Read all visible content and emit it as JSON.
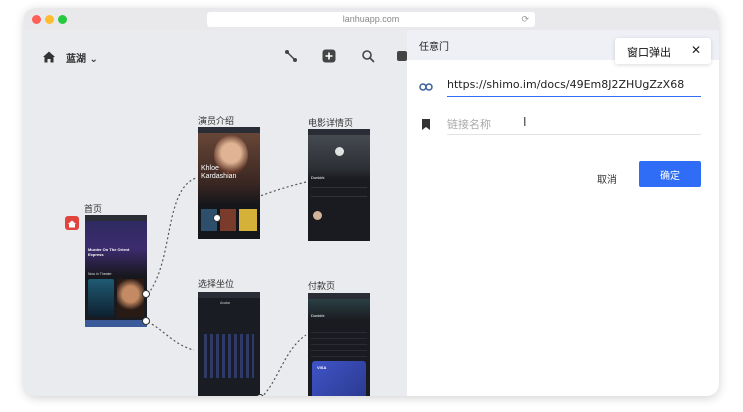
{
  "browser": {
    "url": "lanhuapp.com"
  },
  "toolbar": {
    "project_name": "蓝湖"
  },
  "artboards": {
    "home": {
      "label": "首页",
      "movie_title": "Murder On The Orient Express",
      "section": "Now in Theater"
    },
    "cast": {
      "label": "演员介绍",
      "actor_name": "Khloe Kardashian"
    },
    "detail": {
      "label": "电影详情页",
      "movie_title": "Dunkirk"
    },
    "seat": {
      "label": "选择坐位",
      "cinema": "Avatar"
    },
    "pay": {
      "label": "付款页",
      "movie_title": "Dunkirk",
      "card_brand": "VISA"
    }
  },
  "panel": {
    "title": "任意门",
    "tooltip": "窗口弹出",
    "link_value": "https://shimo.im/docs/49Em8J2ZHUgZzX68",
    "name_placeholder": "链接名称",
    "cancel_label": "取消",
    "confirm_label": "确定"
  },
  "colors": {
    "accent": "#2f6df6",
    "home_badge": "#e0443c"
  }
}
